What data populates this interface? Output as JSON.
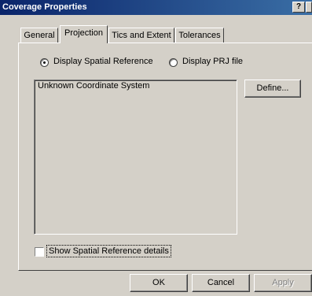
{
  "window": {
    "title": "Coverage Properties",
    "help_label": "?",
    "close_label": "×"
  },
  "tabs": [
    {
      "label": "General"
    },
    {
      "label": "Projection"
    },
    {
      "label": "Tics and Extent"
    },
    {
      "label": "Tolerances"
    }
  ],
  "projection": {
    "radio_spatial_label": "Display Spatial Reference",
    "radio_prj_label": "Display PRJ file",
    "selected": "Display Spatial Reference",
    "coordinate_text": "Unknown Coordinate System",
    "define_label": "Define...",
    "show_details_label": "Show Spatial Reference details",
    "show_details_checked": false
  },
  "footer": {
    "ok_label": "OK",
    "cancel_label": "Cancel",
    "apply_label": "Apply"
  }
}
